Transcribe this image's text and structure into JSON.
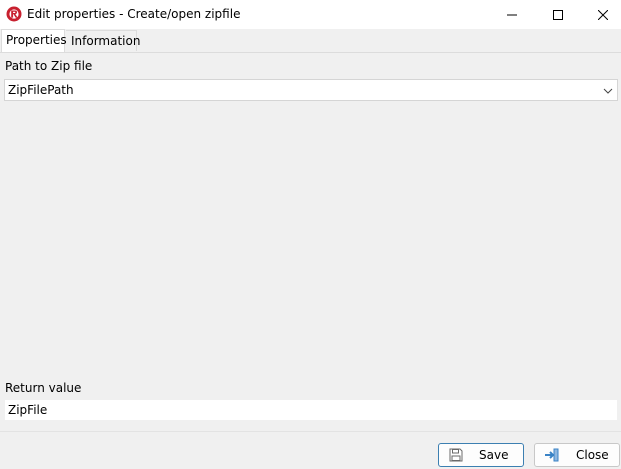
{
  "window": {
    "title": "Edit properties - Create/open zipfile",
    "controls": {
      "minimize": "minimize-icon",
      "maximize": "maximize-icon",
      "close": "close-icon"
    }
  },
  "tabs": [
    {
      "label": "Properties",
      "active": true
    },
    {
      "label": "Information",
      "active": false
    }
  ],
  "path_field": {
    "label": "Path to Zip file",
    "value": "ZipFilePath"
  },
  "return_field": {
    "label": "Return value",
    "value": "ZipFile"
  },
  "buttons": {
    "save_label": "Save",
    "close_label": "Close"
  },
  "colors": {
    "app_icon": "#c8202f",
    "save_border": "#3c7fb1",
    "close_icon_accent": "#3a83c6"
  }
}
